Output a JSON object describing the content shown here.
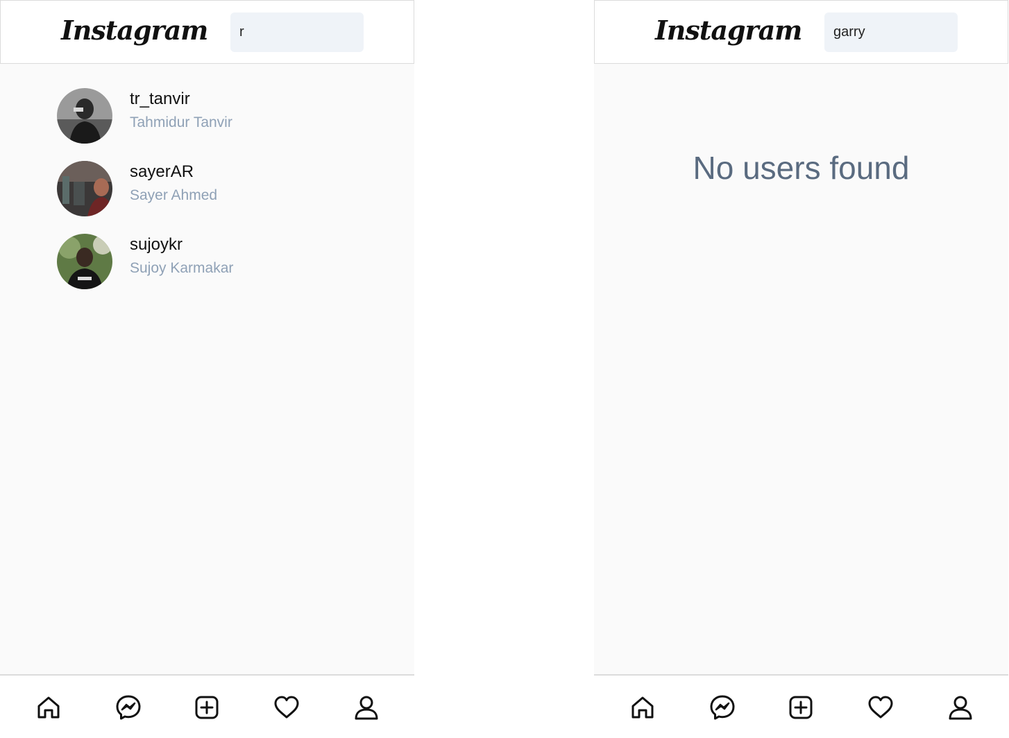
{
  "left_screen": {
    "header": {
      "logo": "Instagram",
      "search_value": "r"
    },
    "results": [
      {
        "username": "tr_tanvir",
        "full_name": "Tahmidur Tanvir"
      },
      {
        "username": "sayerAR",
        "full_name": "Sayer Ahmed"
      },
      {
        "username": "sujoykr",
        "full_name": "Sujoy Karmakar"
      }
    ],
    "nav": [
      "home-icon",
      "messenger-icon",
      "new-post-icon",
      "heart-icon",
      "profile-icon"
    ]
  },
  "right_screen": {
    "header": {
      "logo": "Instagram",
      "search_value": "garry"
    },
    "empty_message": "No users found",
    "nav": [
      "home-icon",
      "messenger-icon",
      "new-post-icon",
      "heart-icon",
      "profile-icon"
    ]
  },
  "colors": {
    "background": "#fafafa",
    "search_bg": "#eff3f8",
    "fullname_text": "#8fa1b6",
    "empty_text": "#5a6b80"
  }
}
